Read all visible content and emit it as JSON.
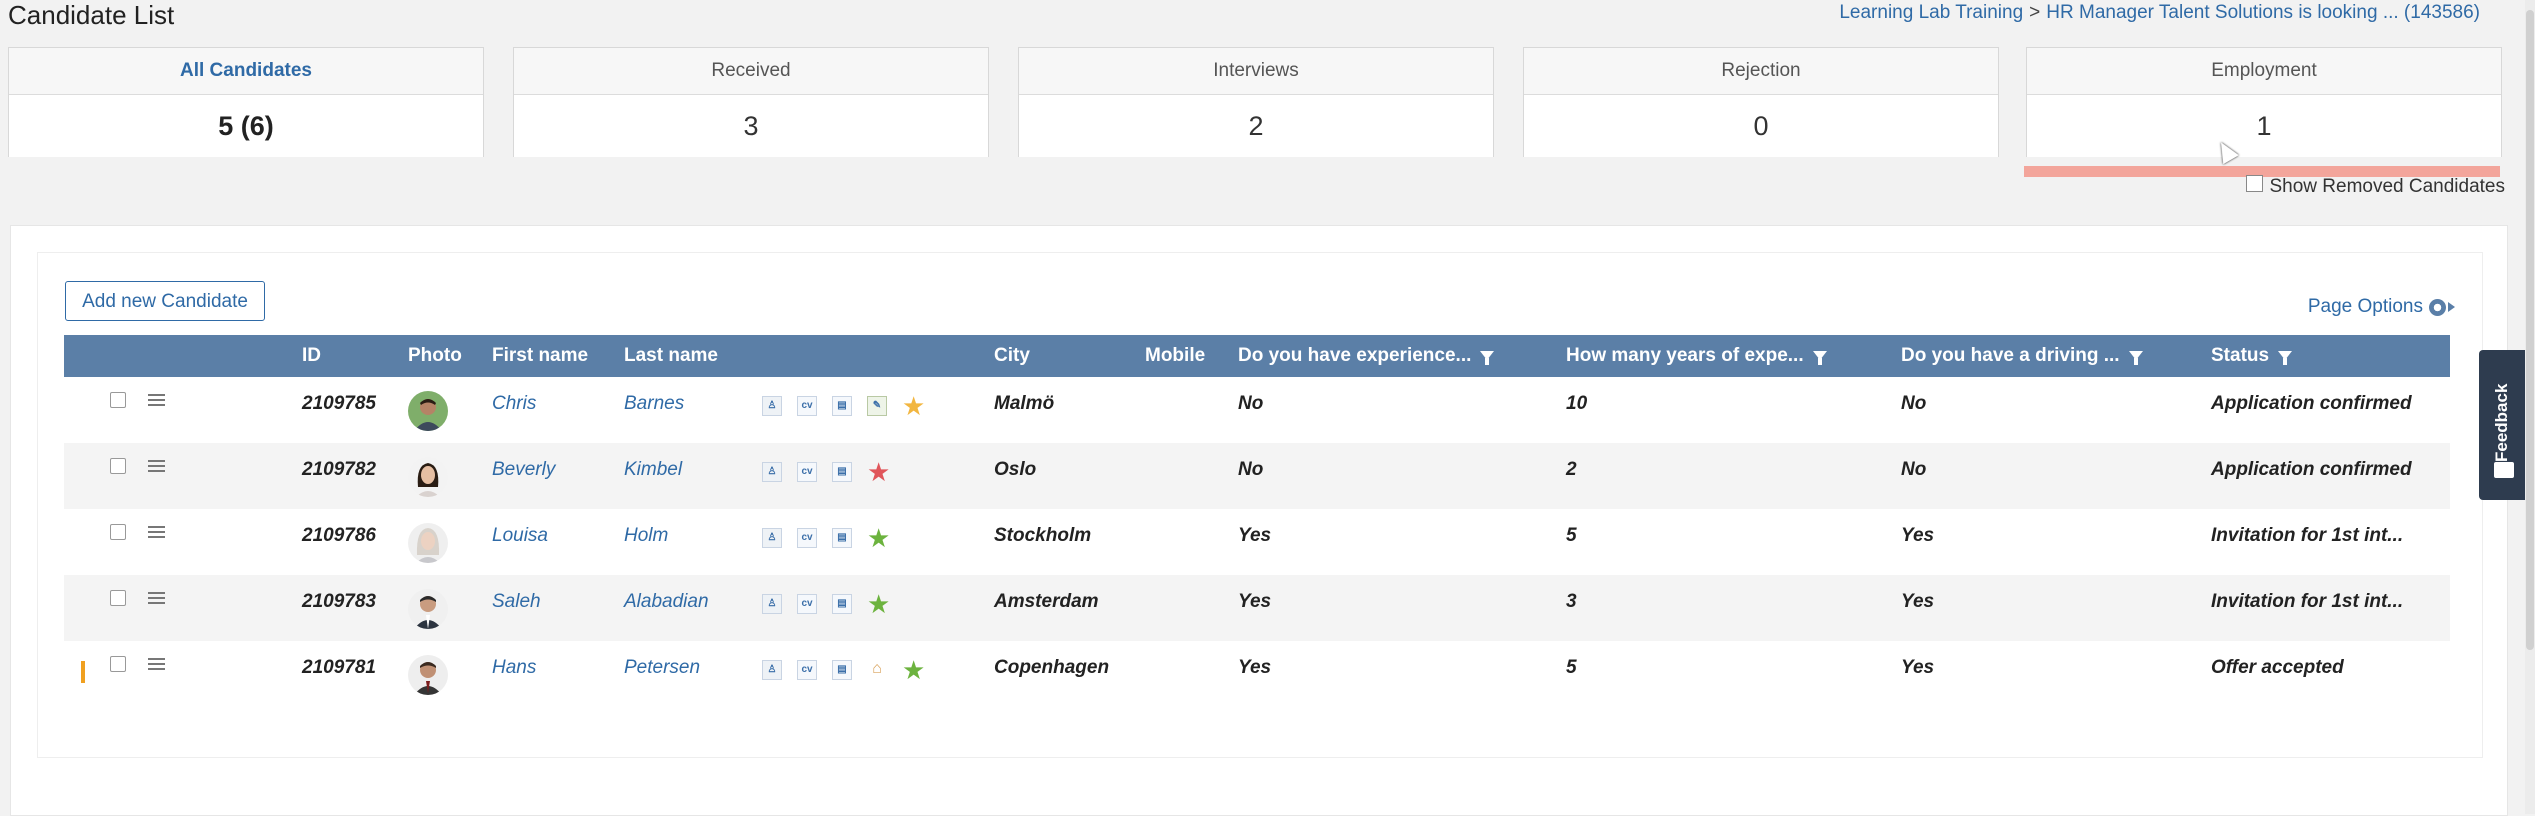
{
  "page": {
    "title": "Candidate List",
    "breadcrumb": {
      "parent": "Learning Lab Training",
      "separator": ">",
      "current": "HR Manager Talent Solutions is looking ... (143586)"
    }
  },
  "tiles": [
    {
      "label": "All Candidates",
      "count": "5 (6)",
      "active": true
    },
    {
      "label": "Received",
      "count": "3"
    },
    {
      "label": "Interviews",
      "count": "2"
    },
    {
      "label": "Rejection",
      "count": "0"
    },
    {
      "label": "Employment",
      "count": "1"
    }
  ],
  "show_removed": {
    "label": "Show Removed Candidates",
    "checked": false
  },
  "toolbar": {
    "add_label": "Add new Candidate",
    "page_options_label": "Page Options"
  },
  "grid": {
    "headers": {
      "id": "ID",
      "photo": "Photo",
      "first_name": "First name",
      "last_name": "Last name",
      "city": "City",
      "mobile": "Mobile",
      "q1": "Do you have experience...",
      "q2": "How many years of expe...",
      "q3": "Do you have a driving ...",
      "status": "Status"
    },
    "rows": [
      {
        "id": "2109785",
        "first": "Chris",
        "last": "Barnes",
        "city": "Malmö",
        "q1": "No",
        "q2": "10",
        "q3": "No",
        "status": "Application confirmed",
        "star_color": "#f2b640",
        "icons": [
          "person",
          "cv",
          "doc",
          "edit"
        ]
      },
      {
        "id": "2109782",
        "first": "Beverly",
        "last": "Kimbel",
        "city": "Oslo",
        "q1": "No",
        "q2": "2",
        "q3": "No",
        "status": "Application confirmed",
        "star_color": "#e0555a",
        "icons": [
          "person",
          "cv",
          "doc"
        ]
      },
      {
        "id": "2109786",
        "first": "Louisa",
        "last": "Holm",
        "city": "Stockholm",
        "q1": "Yes",
        "q2": "5",
        "q3": "Yes",
        "status": "Invitation for 1st int...",
        "star_color": "#6cb33e",
        "icons": [
          "person",
          "cv",
          "doc"
        ]
      },
      {
        "id": "2109783",
        "first": "Saleh",
        "last": "Alabadian",
        "city": "Amsterdam",
        "q1": "Yes",
        "q2": "3",
        "q3": "Yes",
        "status": "Invitation for 1st int...",
        "star_color": "#6cb33e",
        "icons": [
          "person",
          "cv",
          "doc"
        ]
      },
      {
        "id": "2109781",
        "first": "Hans",
        "last": "Petersen",
        "city": "Copenhagen",
        "q1": "Yes",
        "q2": "5",
        "q3": "Yes",
        "status": "Offer accepted",
        "star_color": "#6cb33e",
        "icons": [
          "person",
          "cv",
          "doc",
          "hat"
        ],
        "flagged": true
      }
    ]
  },
  "feedback": {
    "label": "Feedback"
  },
  "colors": {
    "accent": "#2f6aa6",
    "header_bg": "#5b7fa7",
    "highlight": "#f3a59b"
  }
}
